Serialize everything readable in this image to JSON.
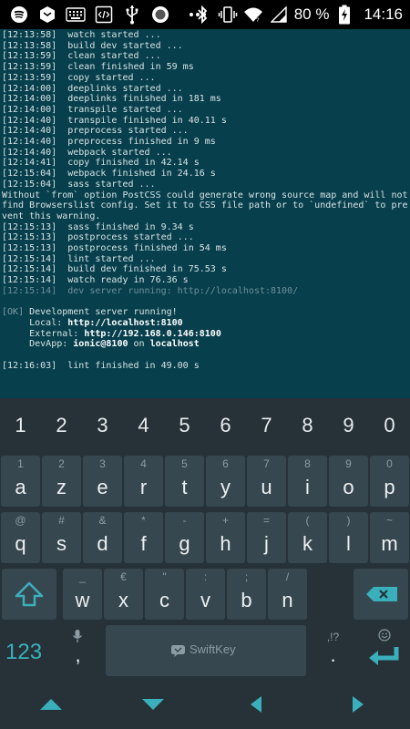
{
  "status_bar": {
    "icons_left": [
      "spotify-icon",
      "app-box-icon",
      "keyboard-icon",
      "code-icon",
      "usb-icon",
      "circle-app-icon",
      "more-icon"
    ],
    "icons_right": [
      "bluetooth-icon",
      "vibrate-icon",
      "wifi-icon",
      "signal-icon",
      "battery-charging-icon"
    ],
    "battery": "80 %",
    "time": "14:16"
  },
  "terminal": {
    "lines": [
      {
        "text": "[12:13:58]  watch started ..."
      },
      {
        "text": "[12:13:58]  build dev started ..."
      },
      {
        "text": "[12:13:59]  clean started ..."
      },
      {
        "text": "[12:13:59]  clean finished in 59 ms"
      },
      {
        "text": "[12:13:59]  copy started ..."
      },
      {
        "text": "[12:14:00]  deeplinks started ..."
      },
      {
        "text": "[12:14:00]  deeplinks finished in 181 ms"
      },
      {
        "text": "[12:14:00]  transpile started ..."
      },
      {
        "text": "[12:14:40]  transpile finished in 40.11 s"
      },
      {
        "text": "[12:14:40]  preprocess started ..."
      },
      {
        "text": "[12:14:40]  preprocess finished in 9 ms"
      },
      {
        "text": "[12:14:40]  webpack started ..."
      },
      {
        "text": "[12:14:41]  copy finished in 42.14 s"
      },
      {
        "text": "[12:15:04]  webpack finished in 24.16 s"
      },
      {
        "text": "[12:15:04]  sass started ..."
      },
      {
        "text": "Without `from` option PostCSS could generate wrong source map and will not find Browserslist config. Set it to CSS file path or to `undefined` to prevent this warning."
      },
      {
        "text": "[12:15:13]  sass finished in 9.34 s"
      },
      {
        "text": "[12:15:13]  postprocess started ..."
      },
      {
        "text": "[12:15:13]  postprocess finished in 54 ms"
      },
      {
        "text": "[12:15:14]  lint started ..."
      },
      {
        "text": "[12:15:14]  build dev finished in 75.53 s"
      },
      {
        "text": "[12:15:14]  watch ready in 76.36 s"
      },
      {
        "text": "[12:15:14]  dev server running: http://localhost:8100/",
        "style": "dim"
      },
      {
        "text": ""
      },
      {
        "text": "[OK] Development server running!",
        "style": "ok"
      },
      {
        "text": "     Local: http://localhost:8100",
        "style": "boldurl",
        "prefix": "     Local: ",
        "bold": "http://localhost:8100"
      },
      {
        "text": "     External: http://192.168.0.146:8100",
        "style": "boldurl",
        "prefix": "     External: ",
        "bold": "http://192.168.0.146:8100"
      },
      {
        "text": "     DevApp: ionic@8100 on localhost",
        "style": "devapp",
        "prefix": "     DevApp: ",
        "bold": "ionic@8100",
        "mid": " on ",
        "bold2": "localhost"
      },
      {
        "text": ""
      },
      {
        "text": "[12:16:03]  lint finished in 49.00 s"
      }
    ]
  },
  "keyboard": {
    "numbers": [
      "1",
      "2",
      "3",
      "4",
      "5",
      "6",
      "7",
      "8",
      "9",
      "0"
    ],
    "row1": [
      {
        "main": "a",
        "hint": "1"
      },
      {
        "main": "z",
        "hint": "2"
      },
      {
        "main": "e",
        "hint": "3"
      },
      {
        "main": "r",
        "hint": "4"
      },
      {
        "main": "t",
        "hint": "5"
      },
      {
        "main": "y",
        "hint": "6"
      },
      {
        "main": "u",
        "hint": "7"
      },
      {
        "main": "i",
        "hint": "8"
      },
      {
        "main": "o",
        "hint": "9"
      },
      {
        "main": "p",
        "hint": "0"
      }
    ],
    "row2": [
      {
        "main": "q",
        "hint": "@"
      },
      {
        "main": "s",
        "hint": "#"
      },
      {
        "main": "d",
        "hint": "&"
      },
      {
        "main": "f",
        "hint": "*"
      },
      {
        "main": "g",
        "hint": "-"
      },
      {
        "main": "h",
        "hint": "+"
      },
      {
        "main": "j",
        "hint": "="
      },
      {
        "main": "k",
        "hint": "("
      },
      {
        "main": "l",
        "hint": ")"
      },
      {
        "main": "m",
        "hint": "~"
      }
    ],
    "row3": [
      {
        "main": "w",
        "hint": "_"
      },
      {
        "main": "x",
        "hint": "€"
      },
      {
        "main": "c",
        "hint": "\""
      },
      {
        "main": "v",
        "hint": ":"
      },
      {
        "main": "b",
        "hint": ";"
      },
      {
        "main": "n",
        "hint": "/"
      }
    ],
    "symbols_label": "123",
    "comma": ",",
    "comma_hint": "🎤",
    "spacebar_brand": "SwiftKey",
    "period": ".",
    "period_hint": ",!?",
    "accent_color": "#3ab0bd"
  },
  "navbar": {
    "buttons": [
      "nav-up-icon",
      "nav-down-icon",
      "nav-left-icon",
      "nav-right-icon"
    ],
    "color": "#3ab0bd"
  }
}
